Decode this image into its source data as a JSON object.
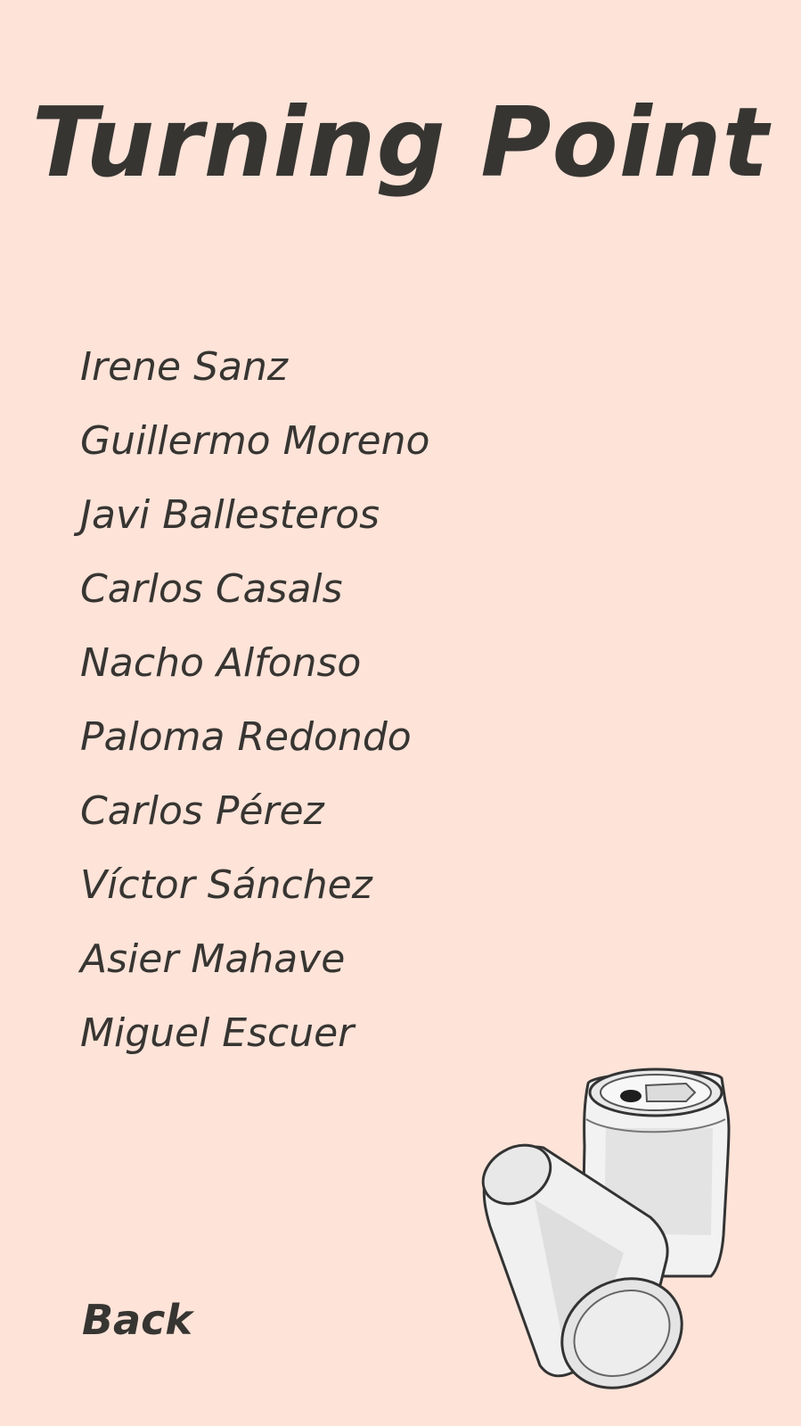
{
  "screen": {
    "title": "Turning Point",
    "background_color": "#fde3d8",
    "text_color": "#373532"
  },
  "credits": [
    "Irene Sanz",
    "Guillermo Moreno",
    "Javi Ballesteros",
    "Carlos Casals",
    "Nacho Alfonso",
    "Paloma Redondo",
    "Carlos Pérez",
    "Víctor Sánchez",
    "Asier Mahave",
    "Miguel Escuer"
  ],
  "back_label": "Back",
  "illustration": "soda-cans-icon"
}
